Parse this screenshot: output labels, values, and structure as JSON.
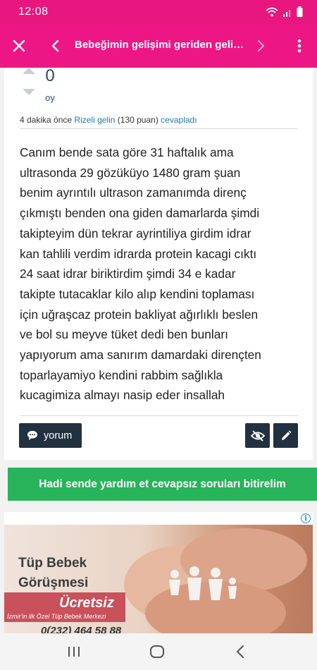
{
  "status_bar": {
    "time": "12:08"
  },
  "app_bar": {
    "title": "Bebeğimin gelişimi geriden geliyo..."
  },
  "vote": {
    "count": "0",
    "unit": "oy"
  },
  "meta": {
    "time_ago": "4 dakika önce",
    "user": "Rizeli gelin",
    "points": "(130 puan)",
    "action": "cevapladı"
  },
  "answer_lines": [
    "Canım bende sata göre 31 haftalık ama",
    "ultrasonda 29 gözüküyo 1480 gram şuan",
    "benim ayrıntılı ultrason zamanımda direnç",
    "çıkmıştı benden ona giden damarlarda şimdi",
    "takipteyim dün tekrar ayrintiliya girdim idrar",
    "kan tahlili verdim idrarda protein kacagi cıktı",
    "24 saat idrar biriktirdim şimdi 34 e kadar",
    "takipte tutacaklar kilo alıp kendini toplaması",
    "için uğraşcaz protein bakliyat ağırlıklı beslen",
    "ve bol su meyve tüket dedi ben bunları",
    "yapıyorum ama sanırım damardaki dirençten",
    "toparlayamiyo kendini rabbim sağlıkla",
    "kucagimiza almayı nasip eder insallah"
  ],
  "buttons": {
    "comment": "yorum"
  },
  "cta": {
    "label": "Hadi sende yardım et cevapsız soruları bitirelim"
  },
  "ad": {
    "line1": "Tüp Bebek",
    "line2": "Görüşmesi",
    "free": "Ücretsiz",
    "sub": "İzmir'in ilk Özel Tüp Bebek Merkezi",
    "phone": "0(232) 464 58 88",
    "info": "i"
  },
  "colors": {
    "primary": "#ec1785",
    "dark_button": "#22313f",
    "cta": "#28b45a",
    "link": "#2277aa"
  }
}
